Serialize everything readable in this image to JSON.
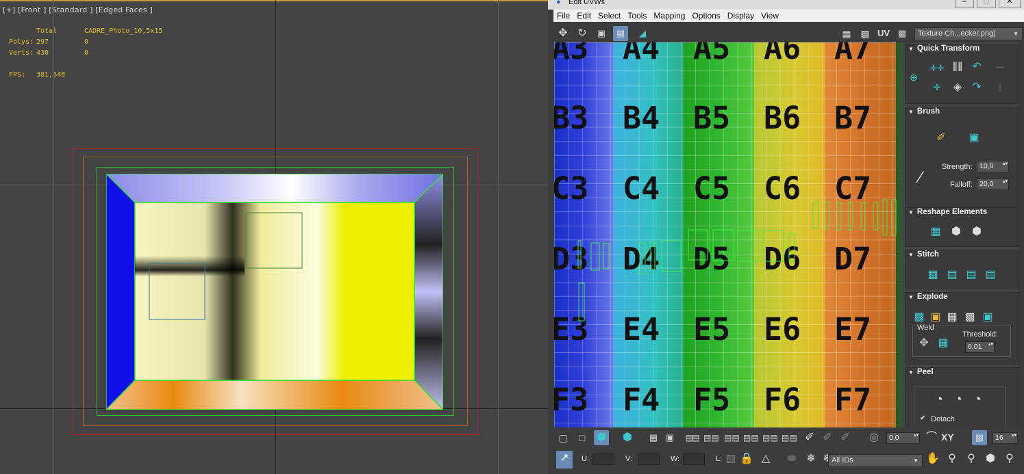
{
  "viewport": {
    "label": "[+] [Front ] [Standard ] [Edged Faces ]",
    "stats": {
      "col_total": "Total",
      "col_object": "CADRE_Photo_10,5x15",
      "polys_label": "Polys:",
      "polys_total": "297",
      "polys_object": "0",
      "verts_label": "Verts:",
      "verts_total": "430",
      "verts_object": "0",
      "fps_label": "FPS:",
      "fps_value": "381,648"
    }
  },
  "uv_editor": {
    "title": "Edit UVWs",
    "menu": [
      "File",
      "Edit",
      "Select",
      "Tools",
      "Mapping",
      "Options",
      "Display",
      "View"
    ],
    "toolbar": {
      "uv_label": "UV",
      "texture_dropdown": "Texture Ch...ecker.png)"
    },
    "checker": {
      "rows": [
        "3",
        "4",
        "5",
        "6",
        "7"
      ],
      "letters": [
        "A",
        "B",
        "C",
        "D",
        "E",
        "F"
      ],
      "columns": [
        "3",
        "4",
        "5",
        "6",
        "7"
      ]
    },
    "panel": {
      "quick_transform": "Quick Transform",
      "brush": "Brush",
      "strength_label": "Strength:",
      "strength_value": "10,0",
      "falloff_label": "Falloff:",
      "falloff_value": "20,0",
      "reshape": "Reshape Elements",
      "stitch": "Stitch",
      "explode": "Explode",
      "weld": "Weld",
      "threshold_label": "Threshold:",
      "threshold_value": "0,01",
      "peel": "Peel",
      "detach": "Detach"
    },
    "bottom": {
      "spin_value": "0,0",
      "xy_label": "XY",
      "grid_value": "16",
      "u_label": "U:",
      "v_label": "V:",
      "w_label": "W:",
      "l_label": "L:",
      "ids_dropdown": "All IDs"
    }
  }
}
